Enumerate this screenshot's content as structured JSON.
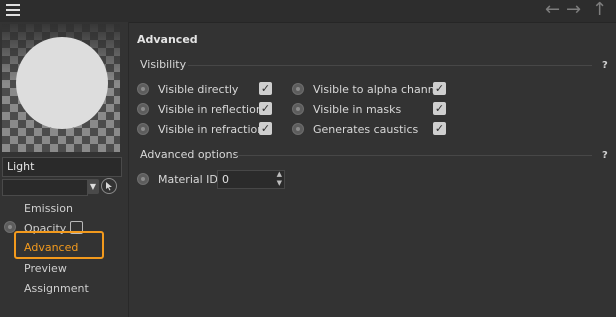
{
  "toolbar": {
    "menu_icon": "hamburger-menu-icon",
    "back_icon": "arrow-left-icon",
    "forward_icon": "arrow-right-icon",
    "up_icon": "arrow-up-icon"
  },
  "left_panel": {
    "material_name": "Light",
    "dropdown_value": "",
    "nav": [
      "Emission",
      "Opacity",
      "Advanced",
      "Preview",
      "Assignment"
    ],
    "active_nav": "Advanced",
    "accent_color": "#f39a1d"
  },
  "main": {
    "title": "Advanced",
    "visibility": {
      "header": "Visibility",
      "help": "?",
      "left_options": [
        {
          "label": "Visible directly",
          "checked": true
        },
        {
          "label": "Visible in reflections",
          "checked": true
        },
        {
          "label": "Visible in refractions",
          "checked": true
        }
      ],
      "right_options": [
        {
          "label": "Visible to alpha channel",
          "checked": true
        },
        {
          "label": "Visible in masks",
          "checked": true
        },
        {
          "label": "Generates caustics",
          "checked": true
        }
      ]
    },
    "advanced_options": {
      "header": "Advanced options",
      "help": "?",
      "material_id_label": "Material ID",
      "material_id_value": "0"
    }
  }
}
